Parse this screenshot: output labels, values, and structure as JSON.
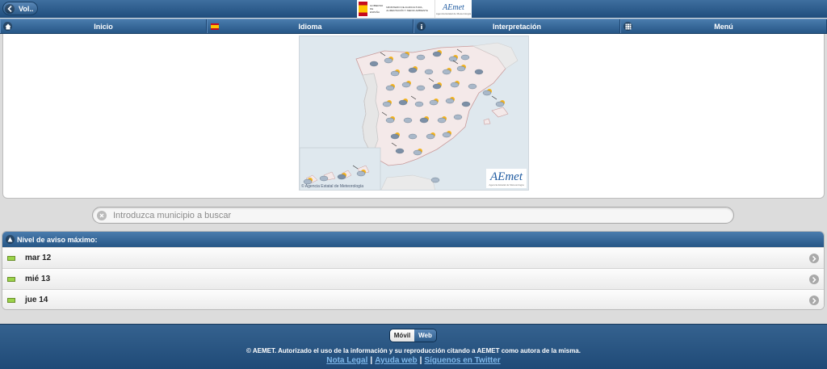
{
  "header": {
    "back_label": "Vol..",
    "gov_logo_text": "GOBIERNO DE ESPAÑA",
    "ministry_text": "MINISTERIO DE AGRICULTURA, ALIMENTACIÓN Y MEDIO AMBIENTE",
    "aemet_logo": "AEmet",
    "aemet_sub": "Agencia Estatal de Meteorología"
  },
  "nav": {
    "items": [
      {
        "label": "Inicio",
        "icon": "home-icon"
      },
      {
        "label": "Idioma",
        "icon": "flag-es-icon"
      },
      {
        "label": "Interpretación",
        "icon": "info-icon"
      },
      {
        "label": "Menú",
        "icon": "grid-icon"
      }
    ]
  },
  "map": {
    "credit": "© Agencia Estatal de Meteorología",
    "logo": "AEmet",
    "logo_sub": "Agencia Estatal de Meteorología",
    "colors": {
      "sea": "#dfe8ee",
      "land": "#f4e9e9",
      "portugal": "#e6e6e6",
      "border": "#c99b9b"
    }
  },
  "search": {
    "placeholder": "Introduzca municipio a buscar",
    "value": ""
  },
  "warnings": {
    "title": "Nivel de aviso máximo:",
    "level_color": "#9bd34a",
    "days": [
      {
        "label": "mar 12"
      },
      {
        "label": "mié 13"
      },
      {
        "label": "jue 14"
      }
    ]
  },
  "footer": {
    "toggle_mobile": "Móvil",
    "toggle_web": "Web",
    "copyright": "© AEMET. Autorizado el uso de la información y su reproducción citando a AEMET como autora de la misma.",
    "links": [
      "Nota Legal",
      "Ayuda web",
      "Síguenos en Twitter"
    ],
    "separator": "|"
  }
}
